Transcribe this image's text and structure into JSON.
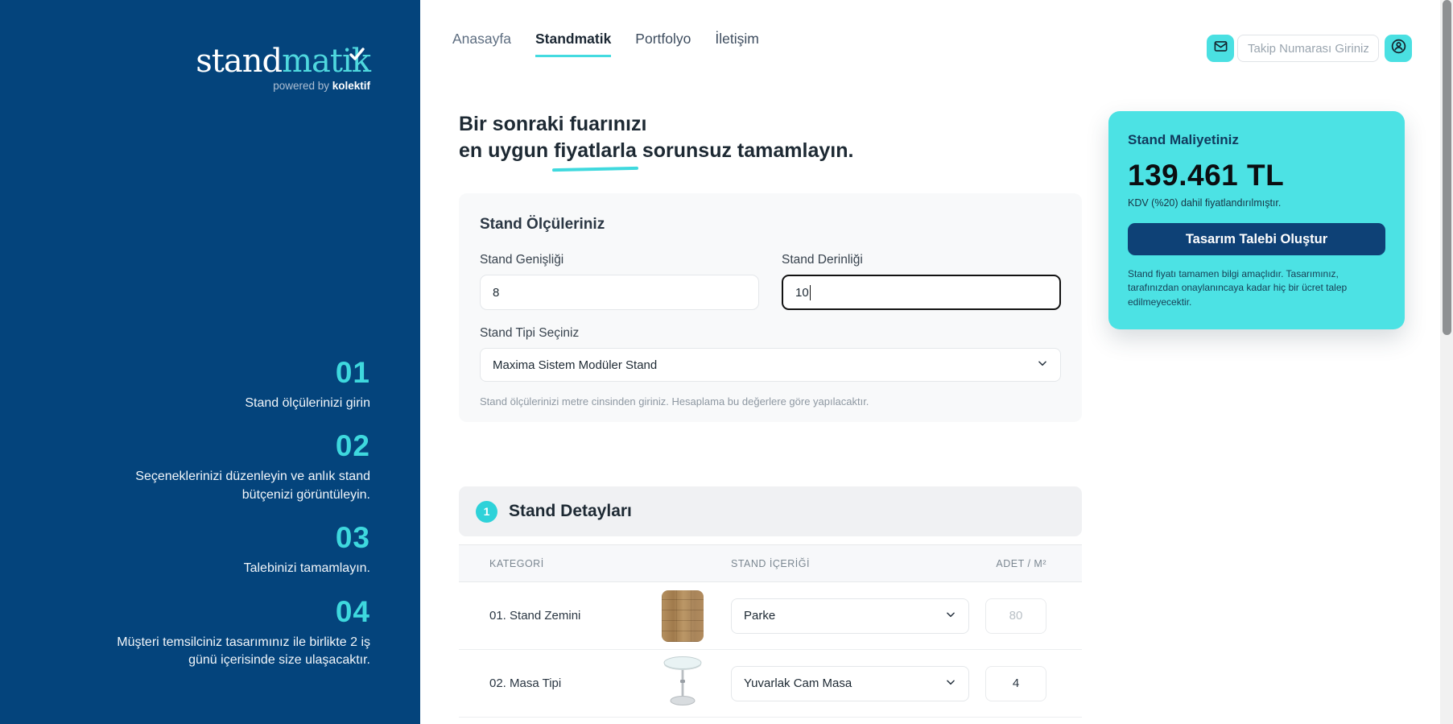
{
  "brand": {
    "name_primary": "stand",
    "name_secondary": "matik",
    "tagline_prefix": "powered by ",
    "tagline_brand": "kolektif"
  },
  "nav": {
    "items": [
      {
        "label": "Anasayfa"
      },
      {
        "label": "Standmatik"
      },
      {
        "label": "Portfolyo"
      },
      {
        "label": "İletişim"
      }
    ]
  },
  "header_actions": {
    "tracking_placeholder": "Takip Numarası Giriniz"
  },
  "hero": {
    "line1": "Bir sonraki fuarınızı",
    "line2_prefix": "en uygun ",
    "line2_highlight": "fiyatlarla",
    "line2_suffix": " sorunsuz tamamlayın."
  },
  "steps": [
    {
      "number": "01",
      "text": "Stand ölçülerinizi girin"
    },
    {
      "number": "02",
      "text": "Seçeneklerinizi düzenleyin ve anlık stand bütçenizi görüntüleyin."
    },
    {
      "number": "03",
      "text": "Talebinizi tamamlayın."
    },
    {
      "number": "04",
      "text": "Müşteri temsilciniz tasarımınız ile birlikte 2 iş günü içerisinde size ulaşacaktır."
    }
  ],
  "measurements": {
    "title": "Stand Ölçüleriniz",
    "width_label": "Stand Genişliği",
    "width_value": "8",
    "depth_label": "Stand Derinliği",
    "depth_value": "10",
    "type_label": "Stand Tipi Seçiniz",
    "type_value": "Maxima Sistem Modüler Stand",
    "help": "Stand ölçülerinizi metre cinsinden giriniz. Hesaplama bu değerlere göre yapılacaktır."
  },
  "cost": {
    "title": "Stand Maliyetiniz",
    "amount": "139.461 TL",
    "vat_note": "KDV (%20) dahil fiyatlandırılmıştır.",
    "cta_label": "Tasarım Talebi Oluştur",
    "disclaimer": "Stand fiyatı tamamen bilgi amaçlıdır. Tasarımınız, tarafınızdan onaylanıncaya kadar hiç bir ücret talep edilmeyecektir."
  },
  "details": {
    "step_badge": "1",
    "title": "Stand Detayları",
    "columns": [
      "KATEGORİ",
      "STAND İÇERİĞİ",
      "ADET / M²"
    ],
    "rows": [
      {
        "category": "01. Stand Zemini",
        "thumb": "parquet-wood",
        "option": "Parke",
        "qty": "80"
      },
      {
        "category": "02. Masa Tipi",
        "thumb": "glass-round-table",
        "option": "Yuvarlak Cam Masa",
        "qty": "4"
      }
    ]
  },
  "colors": {
    "accent_turquoise": "#45dde0",
    "sidebar_navy": "#04447c",
    "cta_navy": "#0e4176"
  }
}
